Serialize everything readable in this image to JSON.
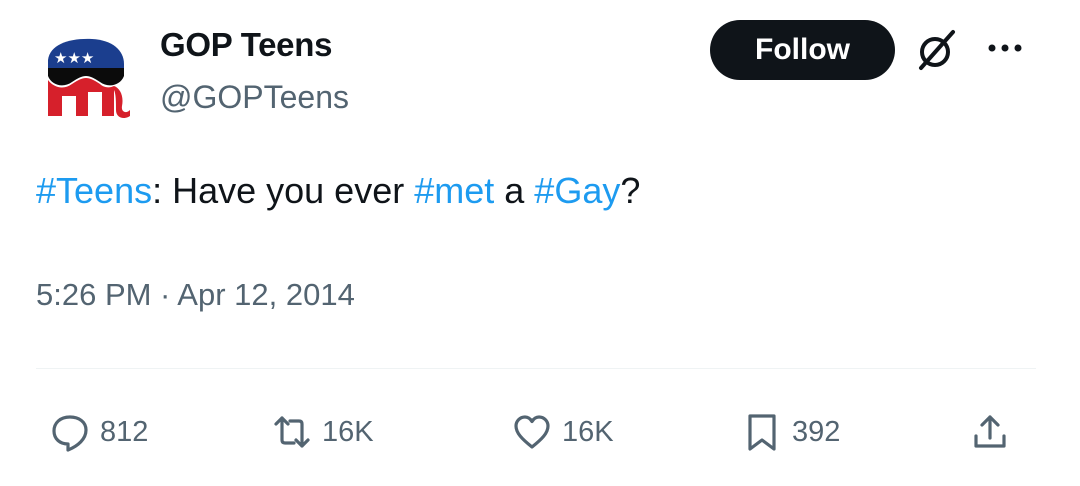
{
  "author": {
    "name": "GOP Teens",
    "handle": "@GOPTeens",
    "avatar_icon": "gop-elephant-logo",
    "follow_label": "Follow"
  },
  "tweet": {
    "segments": [
      {
        "text": "#Teens",
        "hashtag": true
      },
      {
        "text": ": Have you ever ",
        "hashtag": false
      },
      {
        "text": "#met",
        "hashtag": true
      },
      {
        "text": " a ",
        "hashtag": false
      },
      {
        "text": "#Gay",
        "hashtag": true
      },
      {
        "text": "?",
        "hashtag": false
      }
    ],
    "timestamp": "5:26 PM · Apr 12, 2014"
  },
  "actions": {
    "reply": {
      "icon": "reply-icon",
      "count": "812"
    },
    "retweet": {
      "icon": "retweet-icon",
      "count": "16K"
    },
    "like": {
      "icon": "heart-icon",
      "count": "16K"
    },
    "bookmark": {
      "icon": "bookmark-icon",
      "count": "392"
    },
    "share": {
      "icon": "share-icon"
    }
  },
  "colors": {
    "hashtag": "#1d9bf0",
    "secondary_text": "#536471",
    "follow_button": "#0f1419"
  }
}
